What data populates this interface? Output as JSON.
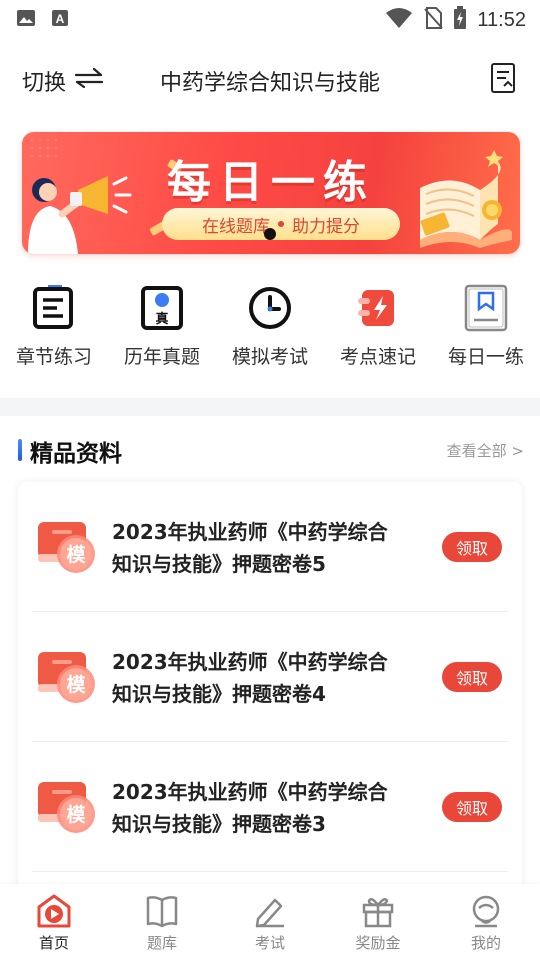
{
  "status_bar": {
    "time": "11:52",
    "icons": [
      "gallery-icon",
      "a-icon",
      "wifi-icon",
      "no-sim-icon",
      "battery-charging-icon"
    ]
  },
  "header": {
    "switch_label": "切换",
    "switch_icon": "swap-arrows-icon",
    "title": "中药学综合知识与技能",
    "right_icon": "document-icon"
  },
  "banner": {
    "title": "每日一练",
    "left_text": "在线题库",
    "right_text": "助力提分"
  },
  "quick_nav": [
    {
      "label": "章节练习",
      "icon": "chapter-list-icon"
    },
    {
      "label": "历年真题",
      "icon": "past-exam-icon"
    },
    {
      "label": "模拟考试",
      "icon": "clock-icon"
    },
    {
      "label": "考点速记",
      "icon": "flash-card-icon"
    },
    {
      "label": "每日一练",
      "icon": "bookmark-book-icon"
    }
  ],
  "section": {
    "title": "精品资料",
    "more": "查看全部 >"
  },
  "materials": [
    {
      "line1": "2023年执业药师《中药学综合",
      "line2": "知识与技能》押题密卷5",
      "badge": "模",
      "button": "领取"
    },
    {
      "line1": "2023年执业药师《中药学综合",
      "line2": "知识与技能》押题密卷4",
      "badge": "模",
      "button": "领取"
    },
    {
      "line1": "2023年执业药师《中药学综合",
      "line2": "知识与技能》押题密卷3",
      "badge": "模",
      "button": "领取"
    }
  ],
  "tabs": [
    {
      "label": "首页",
      "icon": "home-play-icon",
      "active": true
    },
    {
      "label": "题库",
      "icon": "book-icon",
      "active": false
    },
    {
      "label": "考试",
      "icon": "pencil-icon",
      "active": false
    },
    {
      "label": "奖励金",
      "icon": "gift-icon",
      "active": false
    },
    {
      "label": "我的",
      "icon": "profile-icon",
      "active": false
    }
  ],
  "colors": {
    "accent": "#e8473a",
    "banner": "#ff4b46",
    "tab_active": "#e8473a",
    "section_bar": "#2f6ef0"
  }
}
